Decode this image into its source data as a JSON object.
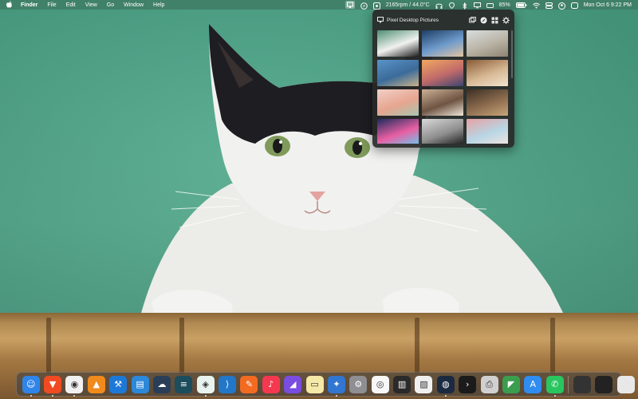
{
  "menubar": {
    "apple_icon": "apple-logo",
    "menus": [
      "Finder",
      "File",
      "Edit",
      "View",
      "Go",
      "Window",
      "Help"
    ],
    "status": {
      "fan_readout": "2165rpm / 44.0°C",
      "battery": "85%",
      "clock": "Mon Oct 6  9:22 PM"
    }
  },
  "popover": {
    "title": "Pixel Desktop Pictures",
    "thumbnails": [
      {
        "name": "cat-photo",
        "colors": [
          "#4e8e72",
          "#f2f2f0",
          "#1d1d1f"
        ]
      },
      {
        "name": "lens-hand",
        "colors": [
          "#1e3e66",
          "#6f9ccc",
          "#e3c3a3"
        ]
      },
      {
        "name": "city-skyline",
        "colors": [
          "#d9ddde",
          "#b9b3a5",
          "#8e8270"
        ]
      },
      {
        "name": "coast-cliffs",
        "colors": [
          "#5b93c8",
          "#3b6b9a",
          "#c9b38a"
        ]
      },
      {
        "name": "sunset-clouds",
        "colors": [
          "#f2a860",
          "#c06a6a",
          "#3d4470"
        ]
      },
      {
        "name": "empty-room",
        "colors": [
          "#8a5a36",
          "#d7b894",
          "#f2e4cf"
        ]
      },
      {
        "name": "pastel-flowers",
        "colors": [
          "#f1d0c8",
          "#e7a58f",
          "#a8c7b0"
        ]
      },
      {
        "name": "pattern-tiles",
        "colors": [
          "#cbb196",
          "#6e5442",
          "#f0e6da"
        ]
      },
      {
        "name": "still-life",
        "colors": [
          "#3c2f25",
          "#8d6d4e",
          "#c9a57a"
        ]
      },
      {
        "name": "paint-splash",
        "colors": [
          "#1f2b5e",
          "#e85fa3",
          "#6cc8ee"
        ]
      },
      {
        "name": "silhouettes",
        "colors": [
          "#d9d9d9",
          "#8f8f8f",
          "#1a1a1a"
        ]
      },
      {
        "name": "pink-building",
        "colors": [
          "#e6a2a5",
          "#b8d6e4",
          "#f3e4e1"
        ]
      }
    ]
  },
  "dock": {
    "apps": [
      {
        "name": "finder-icon",
        "bg": "#2f84e9",
        "glyph": "☺",
        "running": true
      },
      {
        "name": "brave-browser-icon",
        "bg": "#f04a23",
        "glyph": "▼",
        "running": true
      },
      {
        "name": "chrome-icon",
        "bg": "#f1f1f1",
        "glyph": "◉",
        "running": true
      },
      {
        "name": "vlc-icon",
        "bg": "#f08a1c",
        "glyph": "▲",
        "running": false
      },
      {
        "name": "xcode-icon",
        "bg": "#1e78d8",
        "glyph": "⚒",
        "running": false
      },
      {
        "name": "windows-app-icon",
        "bg": "#2c88d9",
        "glyph": "▤",
        "running": false
      },
      {
        "name": "cloud-app-icon",
        "bg": "#2a3f57",
        "glyph": "☁",
        "running": false
      },
      {
        "name": "stack-app-icon",
        "bg": "#1c4d5c",
        "glyph": "≡",
        "running": false
      },
      {
        "name": "mirror-app-icon",
        "bg": "#e8f3ef",
        "glyph": "◈",
        "running": true
      },
      {
        "name": "vscode-icon",
        "bg": "#2277c9",
        "glyph": "⟩",
        "running": false
      },
      {
        "name": "sketch-app-icon",
        "bg": "#f26b21",
        "glyph": "✎",
        "running": false
      },
      {
        "name": "music-icon",
        "bg": "#f5384f",
        "glyph": "♪",
        "running": false
      },
      {
        "name": "tweak-app-icon",
        "bg": "#7a4ce0",
        "glyph": "◢",
        "running": false
      },
      {
        "name": "notes-icon",
        "bg": "#f5e9a8",
        "glyph": "▭",
        "running": false
      },
      {
        "name": "safari-icon",
        "bg": "#3176d1",
        "glyph": "✦",
        "running": true
      },
      {
        "name": "settings-icon",
        "bg": "#8e8e93",
        "glyph": "⚙",
        "running": false
      },
      {
        "name": "screenshot-icon",
        "bg": "#f7f7f7",
        "glyph": "◎",
        "running": false
      },
      {
        "name": "piano-icon",
        "bg": "#2a2a2a",
        "glyph": "▥",
        "running": false
      },
      {
        "name": "preview-icon",
        "bg": "#f0f0f0",
        "glyph": "▨",
        "running": false
      },
      {
        "name": "globe-app-icon",
        "bg": "#1b2a40",
        "glyph": "◍",
        "running": true
      },
      {
        "name": "terminal-icon",
        "bg": "#1b1b1b",
        "glyph": "›",
        "running": false
      },
      {
        "name": "printer-icon",
        "bg": "#d0d0d0",
        "glyph": "⎙",
        "running": false
      },
      {
        "name": "compass-app-icon",
        "bg": "#3a9e4e",
        "glyph": "◤",
        "running": false
      },
      {
        "name": "app-store-icon",
        "bg": "#2f8cf0",
        "glyph": "A",
        "running": false
      },
      {
        "name": "whatsapp-icon",
        "bg": "#29c55f",
        "glyph": "✆",
        "running": true
      }
    ],
    "recents": [
      {
        "name": "recent-window-1-icon",
        "bg": "#333333"
      },
      {
        "name": "recent-window-2-icon",
        "bg": "#222222"
      },
      {
        "name": "recent-window-3-icon",
        "bg": "#e8e8e8"
      },
      {
        "name": "trash-icon",
        "bg": "#8c8c8c"
      }
    ]
  },
  "colors": {
    "wallpaper": "#4fa78b",
    "menubar": "#3f7d65",
    "popover": "#282828"
  }
}
